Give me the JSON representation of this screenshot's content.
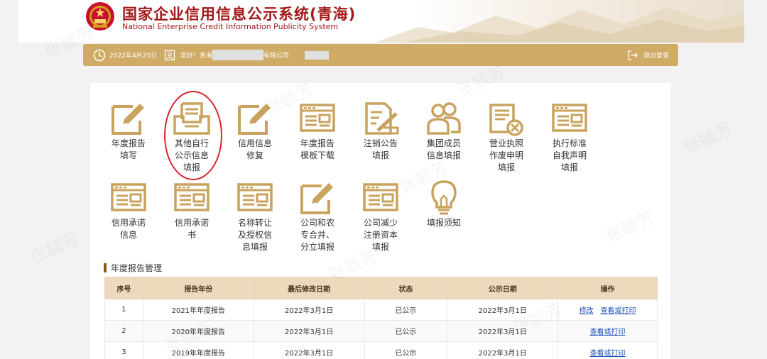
{
  "header": {
    "title_cn": "国家企业信用信息公示系统(青海)",
    "title_en": "National Enterprise Credit Information Publicity System"
  },
  "topbar": {
    "date": "2022年4月25日",
    "greeting_prefix": "您好！青海",
    "greeting_suffix": "有限公司",
    "logout": "退出登录"
  },
  "tiles": [
    {
      "label": "年度报告\n填写",
      "icon": "pencil-doc-icon"
    },
    {
      "label": "其他自行\n公示信息\n填报",
      "icon": "tray-doc-icon"
    },
    {
      "label": "信用信息\n修复",
      "icon": "pencil-doc-icon"
    },
    {
      "label": "年度报告\n模板下载",
      "icon": "form-icon"
    },
    {
      "label": "注销公告\n填报",
      "icon": "doc-slash-icon"
    },
    {
      "label": "集团成员\n信息填报",
      "icon": "group-icon"
    },
    {
      "label": "营业执照\n作废申明\n填报",
      "icon": "doc-x-icon"
    },
    {
      "label": "执行标准\n自我声明\n填报",
      "icon": "form-icon"
    },
    {
      "label": "信用承诺\n信息",
      "icon": "form-icon"
    },
    {
      "label": "信用承诺\n书",
      "icon": "form-icon"
    },
    {
      "label": "名称转让\n及授权信\n息填报",
      "icon": "form-icon"
    },
    {
      "label": "公司和农\n专合并、\n分立填报",
      "icon": "pencil-doc-icon"
    },
    {
      "label": "公司减少\n注册资本\n填报",
      "icon": "form-icon"
    },
    {
      "label": "填报须知",
      "icon": "lightbulb-icon"
    }
  ],
  "section": {
    "title": "年度报告管理"
  },
  "table": {
    "headers": [
      "序号",
      "报告年份",
      "最后修改日期",
      "状态",
      "公示日期",
      "操作"
    ],
    "rows": [
      {
        "no": "1",
        "year": "2021年年度报告",
        "modified": "2022年3月1日",
        "status": "已公示",
        "published": "2022年3月1日",
        "edit": "修改",
        "view": "查看或打印"
      },
      {
        "no": "2",
        "year": "2020年年度报告",
        "modified": "2022年3月1日",
        "status": "已公示",
        "published": "2022年3月1日",
        "edit": "",
        "view": "查看或打印"
      },
      {
        "no": "3",
        "year": "2019年年度报告",
        "modified": "2022年3月1日",
        "status": "已公示",
        "published": "2022年3月1日",
        "edit": "",
        "view": "查看或打印"
      }
    ]
  },
  "watermark": "张毓芳",
  "colors": {
    "gold": "#cfab66",
    "icon_gold": "#c9a35e",
    "title_red": "#a31919",
    "highlight_circle": "#d9232e",
    "link": "#1a4fb8"
  }
}
